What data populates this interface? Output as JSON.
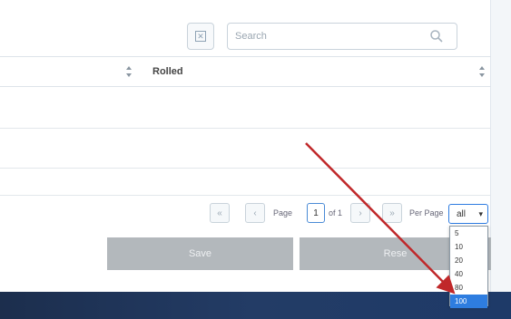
{
  "toolbar": {
    "filter_icon": "clear-filter-icon",
    "search_placeholder": "Search",
    "search_icon": "search-icon"
  },
  "table": {
    "columns": [
      "",
      "Rolled"
    ],
    "rows": [
      {},
      {},
      {},
      {}
    ]
  },
  "pagination": {
    "page_label": "Page",
    "current_page": "1",
    "of_label": "of 1",
    "per_page_label": "Per Page",
    "per_page_value": "all",
    "per_page_options": [
      "5",
      "10",
      "20",
      "40",
      "80",
      "100"
    ],
    "per_page_highlighted": "100"
  },
  "actions": {
    "save_label": "Save",
    "second_label": "Rese"
  },
  "colors": {
    "accent": "#2e7de0",
    "arrow": "#c0282a",
    "button_gray": "#b3b8bc",
    "taskbar": "#1e3459"
  }
}
